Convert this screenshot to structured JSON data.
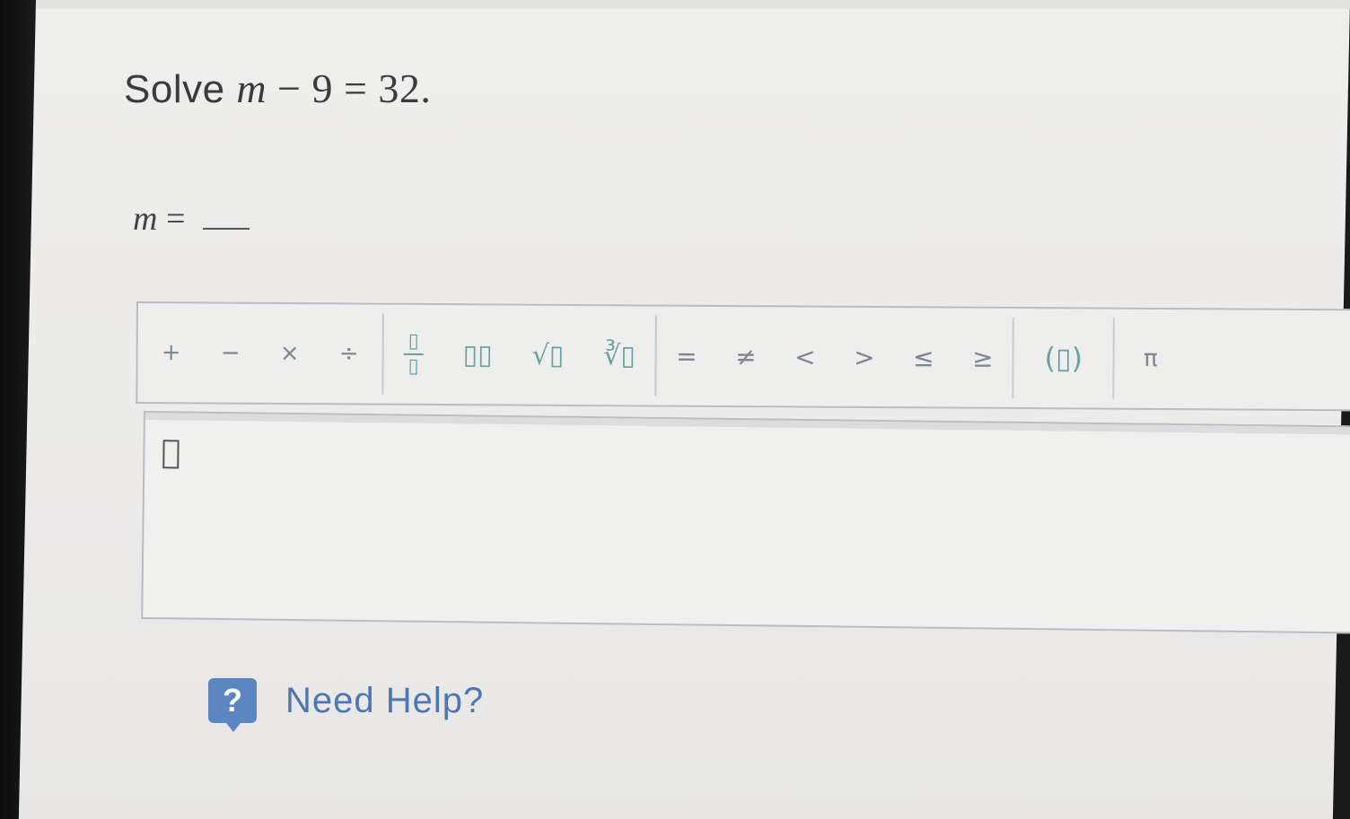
{
  "question": {
    "prefix": "Solve",
    "variable": "m",
    "equation_rest": "− 9 = 32."
  },
  "answer": {
    "variable": "m",
    "equals": "="
  },
  "toolbar": {
    "basic_ops": [
      "+",
      "−",
      "×",
      "÷"
    ],
    "fraction": {
      "numerator": "▯",
      "denominator": "▯"
    },
    "power": "▯▯",
    "sqrt": "√▯",
    "nth_root": "∛▯",
    "relations": [
      "=",
      "≠",
      "<",
      ">",
      "≤",
      "≥"
    ],
    "parens": "(▯)",
    "pi": "π"
  },
  "editor": {
    "placeholder_box": ""
  },
  "help": {
    "icon_label": "?",
    "text": "Need Help?"
  },
  "colors": {
    "accent": "#6aa0a4",
    "help_blue": "#5b86c2",
    "help_text": "#4d77b2"
  }
}
